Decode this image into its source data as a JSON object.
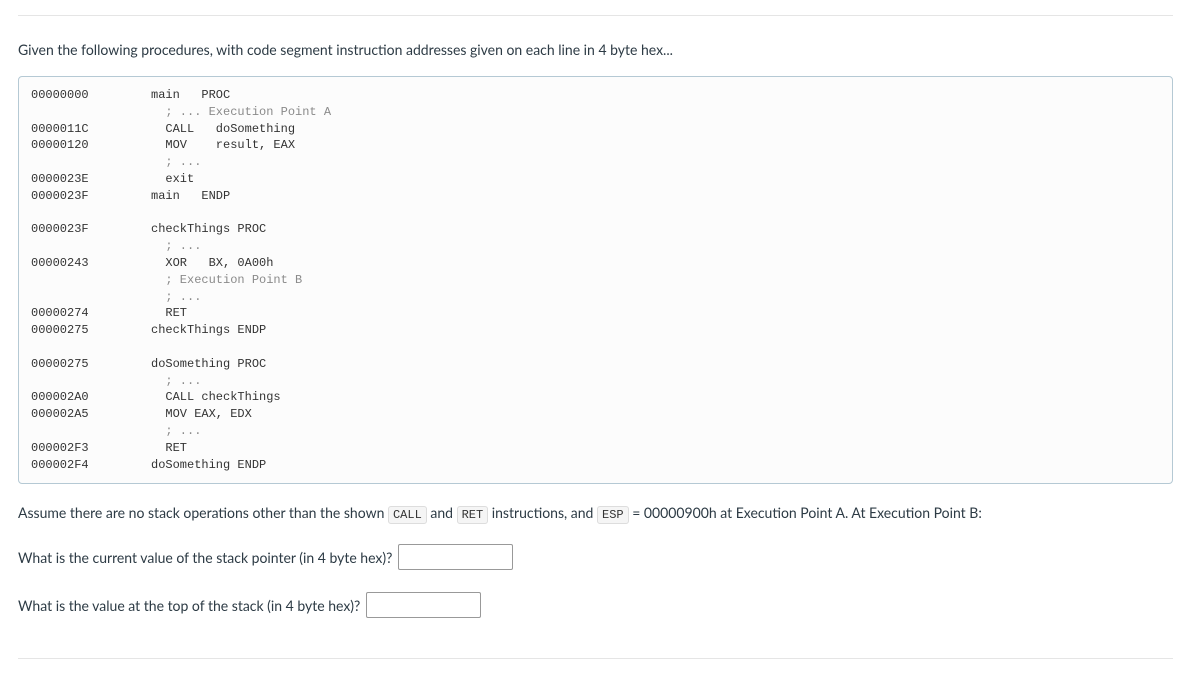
{
  "title": "Given the following procedures, with code segment instruction addresses given on each line in 4 byte hex...",
  "code": {
    "l1_addr": "00000000",
    "l1_code": "main   PROC",
    "l2_code": "  ; ... Execution Point A",
    "l3_addr": "0000011C",
    "l3_code": "  CALL   doSomething",
    "l4_addr": "00000120",
    "l4_code": "  MOV    result, EAX",
    "l5_code": "  ; ...",
    "l6_addr": "0000023E",
    "l6_code": "  exit",
    "l7_addr": "0000023F",
    "l7_code": "main   ENDP",
    "l8_addr": "0000023F",
    "l8_code": "checkThings PROC",
    "l9_code": "  ; ...",
    "l10_addr": "00000243",
    "l10_code": "  XOR   BX, 0A00h",
    "l11_code": "  ; Execution Point B",
    "l12_code": "  ; ...",
    "l13_addr": "00000274",
    "l13_code": "  RET",
    "l14_addr": "00000275",
    "l14_code": "checkThings ENDP",
    "l15_addr": "00000275",
    "l15_code": "doSomething PROC",
    "l16_code": "  ; ...",
    "l17_addr": "000002A0",
    "l17_code": "  CALL checkThings",
    "l18_addr": "000002A5",
    "l18_code": "  MOV EAX, EDX",
    "l19_code": "  ; ...",
    "l20_addr": "000002F3",
    "l20_code": "  RET",
    "l21_addr": "000002F4",
    "l21_code": "doSomething ENDP"
  },
  "assume": {
    "prefix": "Assume there are no stack operations other than the shown ",
    "call": "CALL",
    "mid1": " and ",
    "ret": "RET",
    "mid2": " instructions, and ",
    "esp": "ESP",
    "suffix": " = 00000900h at Execution Point A. At Execution Point B:"
  },
  "q1": "What is the current value of the stack pointer (in 4 byte hex)?",
  "q2": "What is the value at the top of the stack (in 4 byte hex)?"
}
